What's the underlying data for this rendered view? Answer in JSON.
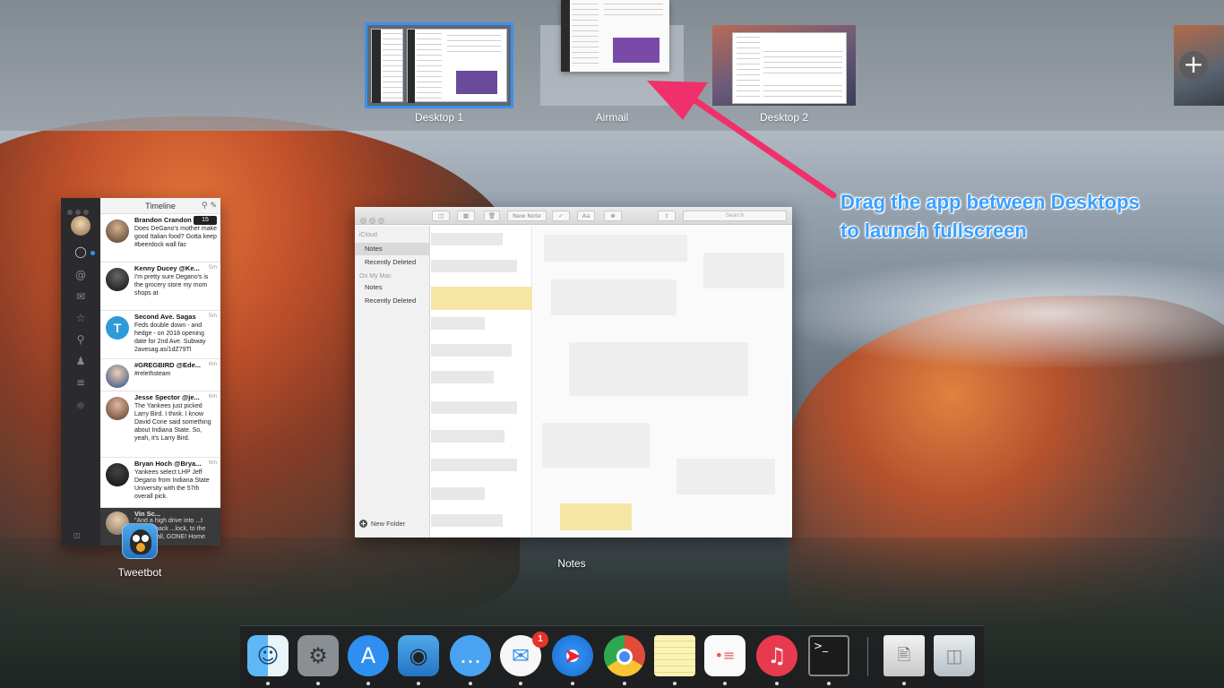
{
  "spaces": {
    "desktop1_label": "Desktop 1",
    "airmail_label": "Airmail",
    "desktop2_label": "Desktop 2",
    "add_space_symbol": "+",
    "selected": "Desktop 1",
    "accent_color": "#3c8ff0"
  },
  "annotation": {
    "line1": "Drag the app between Desktops",
    "line2": "to launch fullscreen",
    "text_color": "#3aa0ff",
    "arrow_color": "#f0306a"
  },
  "tweetbot_window": {
    "title": "Timeline",
    "unread_badge": "15",
    "sidebar_icons": [
      "avatar",
      "chat-icon",
      "mention-icon",
      "mail-icon",
      "star-icon",
      "search-icon",
      "profile-icon",
      "list-icon",
      "message-icon",
      "split-view-icon"
    ],
    "tweets": [
      {
        "name": "Brandon Crandon",
        "time": "",
        "body": "Does DeGano's mother make good Italian food? Gotta keep #beerdock wall fac"
      },
      {
        "name": "Kenny Ducey @Ke...",
        "time": "5m",
        "body": "I'm pretty sure Degano's is the grocery store my mom shops at"
      },
      {
        "name": "Second Ave. Sagas",
        "time": "5m",
        "body": "Feds double down - and hedge - on 2018 opening date for 2nd Ave. Subway 2avesag.as/1dZ79Tl"
      },
      {
        "name": "#GREGBIRD @Ede...",
        "time": "6m",
        "body": "#relethsteam"
      },
      {
        "name": "Jesse Spector @je...",
        "time": "6m",
        "body": "The Yankees just picked Larry Bird. I think. I know David Cone said something about Indiana State. So, yeah, it's Larry Bird."
      },
      {
        "name": "Bryan Hoch @Brya...",
        "time": "6m",
        "body": "Yankees select LHP Jeff Degano from Indiana State University with the 57th overall pick."
      }
    ],
    "bottom_tweet": {
      "name": "Vin Sc...",
      "body": "\"And a high drive into ...t center, back ...lock, to the track, ...all, GONE! Home"
    }
  },
  "tweetbot_app": {
    "label": "Tweetbot"
  },
  "notes_window": {
    "toolbar": {
      "new_note": "New Note",
      "search_placeholder": "Search"
    },
    "sidebar": {
      "icloud_header": "iCloud",
      "icloud_notes": "Notes",
      "icloud_recently_deleted": "Recently Deleted",
      "on_my_mac_header": "On My Mac",
      "mac_notes": "Notes",
      "mac_recently_deleted": "Recently Deleted",
      "new_folder": "New Folder"
    }
  },
  "notes_app": {
    "label": "Notes"
  },
  "dock": {
    "items": [
      {
        "name": "Finder",
        "icon": "finder-icon"
      },
      {
        "name": "System Preferences",
        "icon": "gear-icon"
      },
      {
        "name": "App Store",
        "icon": "appstore-icon"
      },
      {
        "name": "Tweetbot",
        "icon": "tweetbot-icon"
      },
      {
        "name": "Messages",
        "icon": "messages-icon"
      },
      {
        "name": "Airmail",
        "icon": "airmail-icon"
      },
      {
        "name": "Safari",
        "icon": "safari-icon"
      },
      {
        "name": "Chrome",
        "icon": "chrome-icon"
      },
      {
        "name": "Notes",
        "icon": "notes-icon"
      },
      {
        "name": "Reminders",
        "icon": "reminders-icon"
      },
      {
        "name": "iTunes",
        "icon": "itunes-icon"
      },
      {
        "name": "Terminal",
        "icon": "terminal-icon"
      },
      {
        "name": "Preview",
        "icon": "preview-icon"
      },
      {
        "name": "Trash",
        "icon": "trash-icon"
      }
    ],
    "airmail_badge": "1",
    "terminal_prompt": ">_"
  }
}
